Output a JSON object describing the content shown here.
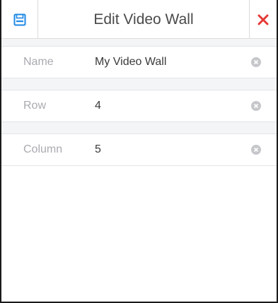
{
  "dialog": {
    "title": "Edit Video Wall"
  },
  "icons": {
    "save": "save-icon",
    "close": "close-icon",
    "clear": "clear-circle-icon"
  },
  "colors": {
    "accent": "#1e88e5",
    "close": "#e53935",
    "label": "#a9abb0",
    "value": "#3a3a3a",
    "separator": "#f4f5f7"
  },
  "fields": [
    {
      "label": "Name",
      "value": "My Video Wall"
    },
    {
      "label": "Row",
      "value": "4"
    },
    {
      "label": "Column",
      "value": "5"
    }
  ]
}
